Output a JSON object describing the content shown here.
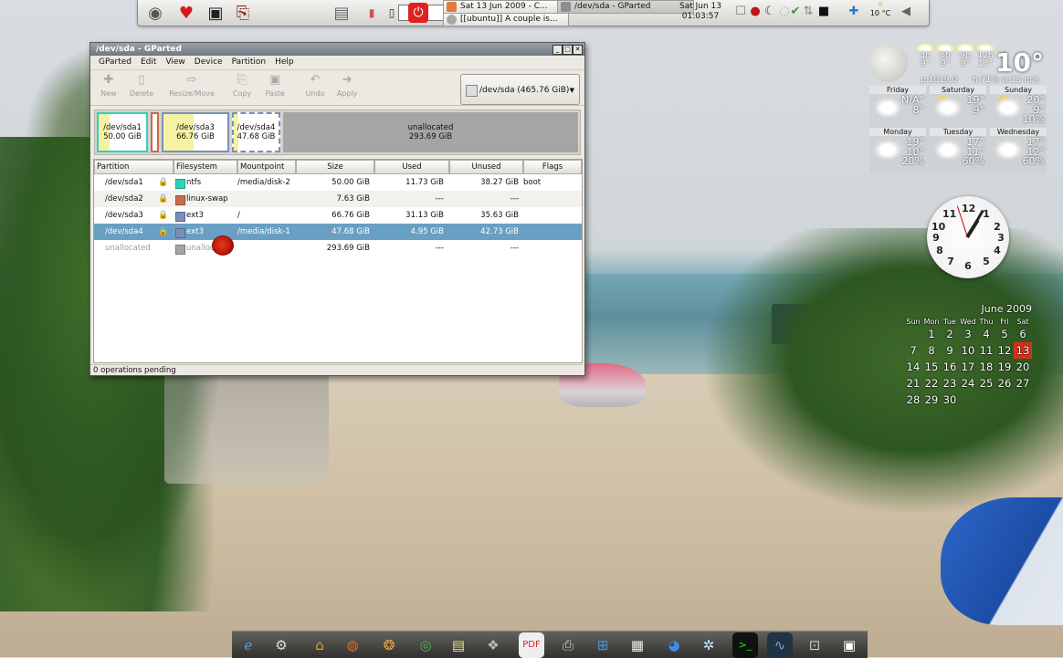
{
  "top_panel": {
    "tasks": [
      {
        "label": "Sat 13 Jun 2009 - C...",
        "active": false
      },
      {
        "label": "/dev/sda - GParted",
        "active": true
      },
      {
        "label": "[[ubuntu]] A couple is...",
        "active": false
      }
    ],
    "clock_date": "Sat Jun 13",
    "clock_time": "01:03:57",
    "tray_temp": "10 °C",
    "launchers": [
      "dock-icon",
      "heart-icon",
      "terminal-icon",
      "book-icon"
    ],
    "tray_icons": [
      "checkbox-icon",
      "mushroom-icon",
      "moon-icon",
      "check-icon",
      "network-icon",
      "display-icon",
      "puzzle-icon",
      "weather-icon",
      "speaker-icon"
    ]
  },
  "window": {
    "title": "/dev/sda - GParted",
    "menu": [
      "GParted",
      "Edit",
      "View",
      "Device",
      "Partition",
      "Help"
    ],
    "toolbar": [
      {
        "label": "New",
        "icon": "new-icon"
      },
      {
        "label": "Delete",
        "icon": "delete-icon"
      },
      {
        "label": "Resize/Move",
        "icon": "resize-icon"
      },
      {
        "label": "Copy",
        "icon": "copy-icon"
      },
      {
        "label": "Paste",
        "icon": "paste-icon"
      },
      {
        "label": "Undo",
        "icon": "undo-icon"
      },
      {
        "label": "Apply",
        "icon": "apply-icon"
      }
    ],
    "device_combo": "/dev/sda   (465.76 GiB)",
    "disk_map": [
      {
        "name": "/dev/sda1",
        "size": "50.00 GiB",
        "color": "#2ed3b4"
      },
      {
        "name": "",
        "size": "",
        "color": "#c76b4b"
      },
      {
        "name": "/dev/sda3",
        "size": "66.76 GiB",
        "color": "#7b8fb8"
      },
      {
        "name": "/dev/sda4",
        "size": "47.68 GiB",
        "color": "#7b8fb8"
      },
      {
        "name": "unallocated",
        "size": "293.69 GiB",
        "color": "#a5a5a5"
      }
    ],
    "columns": [
      "Partition",
      "Filesystem",
      "Mountpoint",
      "Size",
      "Used",
      "Unused",
      "Flags"
    ],
    "rows": [
      {
        "partition": "/dev/sda1",
        "filesystem": "ntfs",
        "fs_color": "#2ed3b4",
        "mountpoint": "/media/disk-2",
        "size": "50.00 GiB",
        "used": "11.73 GiB",
        "unused": "38.27 GiB",
        "flags": "boot",
        "locked": true
      },
      {
        "partition": "/dev/sda2",
        "filesystem": "linux-swap",
        "fs_color": "#c76b4b",
        "mountpoint": "",
        "size": "7.63 GiB",
        "used": "---",
        "unused": "---",
        "flags": "",
        "locked": true
      },
      {
        "partition": "/dev/sda3",
        "filesystem": "ext3",
        "fs_color": "#7b8fb8",
        "mountpoint": "/",
        "size": "66.76 GiB",
        "used": "31.13 GiB",
        "unused": "35.63 GiB",
        "flags": "",
        "locked": true
      },
      {
        "partition": "/dev/sda4",
        "filesystem": "ext3",
        "fs_color": "#7b8fb8",
        "mountpoint": "/media/disk-1",
        "size": "47.68 GiB",
        "used": "4.95 GiB",
        "unused": "42.73 GiB",
        "flags": "",
        "locked": true
      },
      {
        "partition": "unallocated",
        "filesystem": "unalloc",
        "fs_color": "#a5a5a5",
        "mountpoint": "",
        "size": "293.69 GiB",
        "used": "---",
        "unused": "---",
        "flags": "",
        "locked": false
      }
    ],
    "status": "0 operations pending"
  },
  "weather": {
    "current_temp": "10°",
    "pressure": "p:1019.0",
    "humidity": "h:71%",
    "wind": "w:13 m/s",
    "hours": [
      {
        "label": "3h",
        "temp": "9°"
      },
      {
        "label": "6h",
        "temp": "9°"
      },
      {
        "label": "9h",
        "temp": "9°"
      },
      {
        "label": "12h",
        "temp": "13°"
      }
    ],
    "days": [
      {
        "name": "Friday",
        "hi": "N/A°",
        "lo": "8°",
        "precip": ""
      },
      {
        "name": "Saturday",
        "hi": "19°",
        "lo": "9°",
        "precip": ""
      },
      {
        "name": "Sunday",
        "hi": "20°",
        "lo": "9°",
        "precip": "10%"
      },
      {
        "name": "Monday",
        "hi": "19°",
        "lo": "10°",
        "precip": "20%"
      },
      {
        "name": "Tuesday",
        "hi": "17°",
        "lo": "11°",
        "precip": "60%"
      },
      {
        "name": "Wednesday",
        "hi": "17°",
        "lo": "12°",
        "precip": "60%"
      }
    ]
  },
  "clock": {
    "hour": 1,
    "minute": 4,
    "second": 57
  },
  "calendar": {
    "month": "June 2009",
    "weekdays": [
      "Sun",
      "Mon",
      "Tue",
      "Wed",
      "Thu",
      "Fri",
      "Sat"
    ],
    "weeks": [
      [
        "",
        "1",
        "2",
        "3",
        "4",
        "5",
        "6"
      ],
      [
        "7",
        "8",
        "9",
        "10",
        "11",
        "12",
        "13"
      ],
      [
        "14",
        "15",
        "16",
        "17",
        "18",
        "19",
        "20"
      ],
      [
        "21",
        "22",
        "23",
        "24",
        "25",
        "26",
        "27"
      ],
      [
        "28",
        "29",
        "30",
        "",
        "",
        "",
        ""
      ]
    ],
    "today": "13"
  },
  "dock": [
    "ie-icon",
    "tools-icon",
    "home-icon",
    "firefox-icon",
    "seashell-icon",
    "globe-icon",
    "notes-icon",
    "gimp-icon",
    "pdf-icon",
    "printer-icon",
    "windows-icon",
    "calendar-icon",
    "web-icon",
    "network-star-icon",
    "terminal-icon",
    "monitor-icon",
    "network-icon",
    "screenshot-icon"
  ]
}
